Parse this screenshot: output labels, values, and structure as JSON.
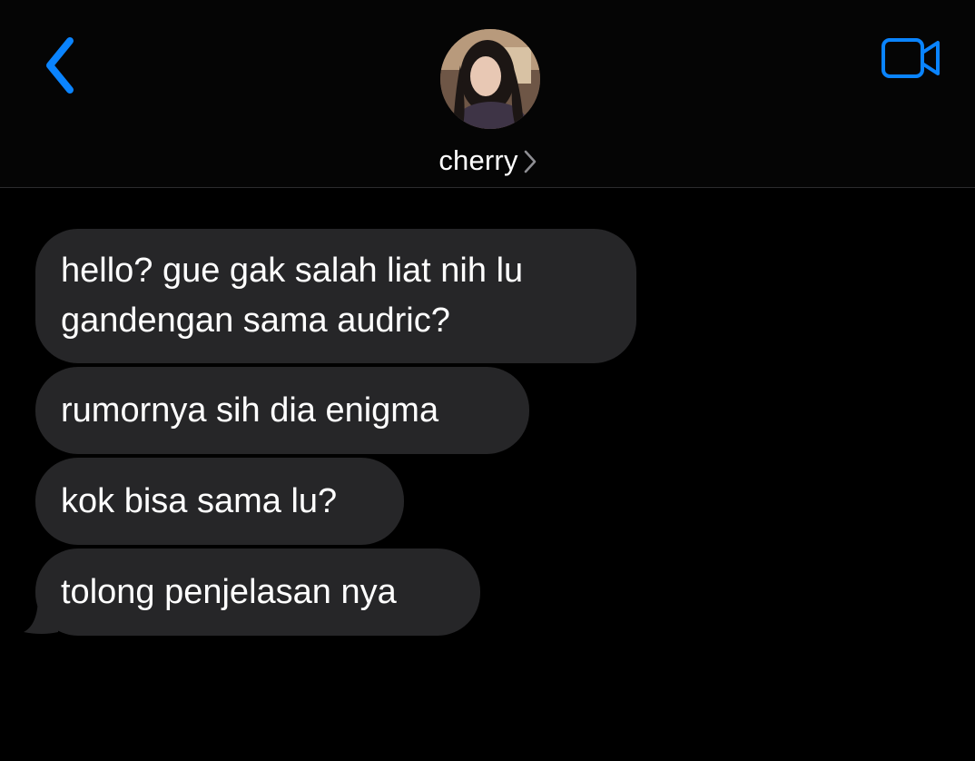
{
  "colors": {
    "accent": "#0a84ff",
    "background": "#000000",
    "bubble": "#262628",
    "text": "#ffffff"
  },
  "header": {
    "back_icon": "chevron-left-icon",
    "video_icon": "video-camera-icon",
    "contact_name": "cherry",
    "name_chevron_icon": "chevron-right-icon"
  },
  "messages": [
    {
      "text": "hello? gue gak salah liat nih lu gandengan sama audric?"
    },
    {
      "text": "rumornya sih dia enigma"
    },
    {
      "text": "kok bisa sama lu?"
    },
    {
      "text": "tolong penjelasan nya"
    }
  ]
}
